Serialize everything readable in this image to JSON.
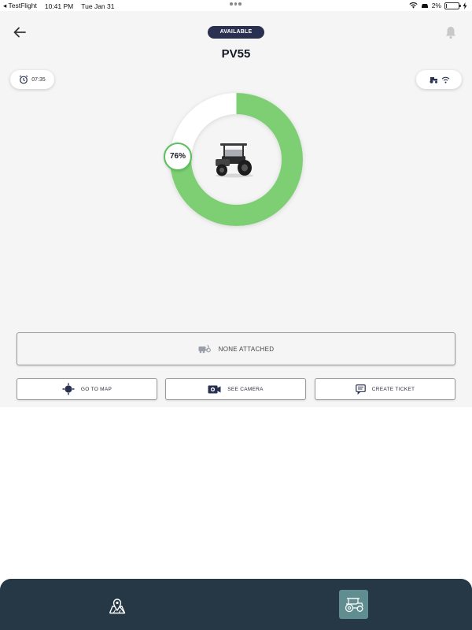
{
  "status_bar": {
    "app": "◂ TestFlight",
    "time": "10:41 PM",
    "date": "Tue Jan 31",
    "battery": "2%",
    "battery_level": 0.02
  },
  "header": {
    "status_label": "AVAILABLE",
    "vehicle_name": "PV55",
    "back_icon": "arrow-left-icon",
    "bell_icon": "bell-icon"
  },
  "chips": {
    "timer_value": "07:35",
    "timer_icon": "alarm-clock-icon",
    "connection_icons": [
      "tractor-icon",
      "wifi-icon"
    ]
  },
  "charge": {
    "percent_label": "76%",
    "level": 0.76,
    "fill_color": "#7ecf74",
    "track_color": "#ffffff"
  },
  "implement": {
    "label": "NONE ATTACHED",
    "icon": "implement-icon"
  },
  "actions": [
    {
      "label": "GO TO MAP",
      "icon": "crosshair-icon"
    },
    {
      "label": "SEE CAMERA",
      "icon": "camera-icon"
    },
    {
      "label": "CREATE TICKET",
      "icon": "ticket-icon"
    }
  ],
  "bottom_nav": {
    "items": [
      {
        "icon": "map-pin-icon",
        "active": false
      },
      {
        "icon": "tractor-icon",
        "active": true
      }
    ],
    "active_color": "#5f8d90",
    "bg_color": "#263745"
  }
}
